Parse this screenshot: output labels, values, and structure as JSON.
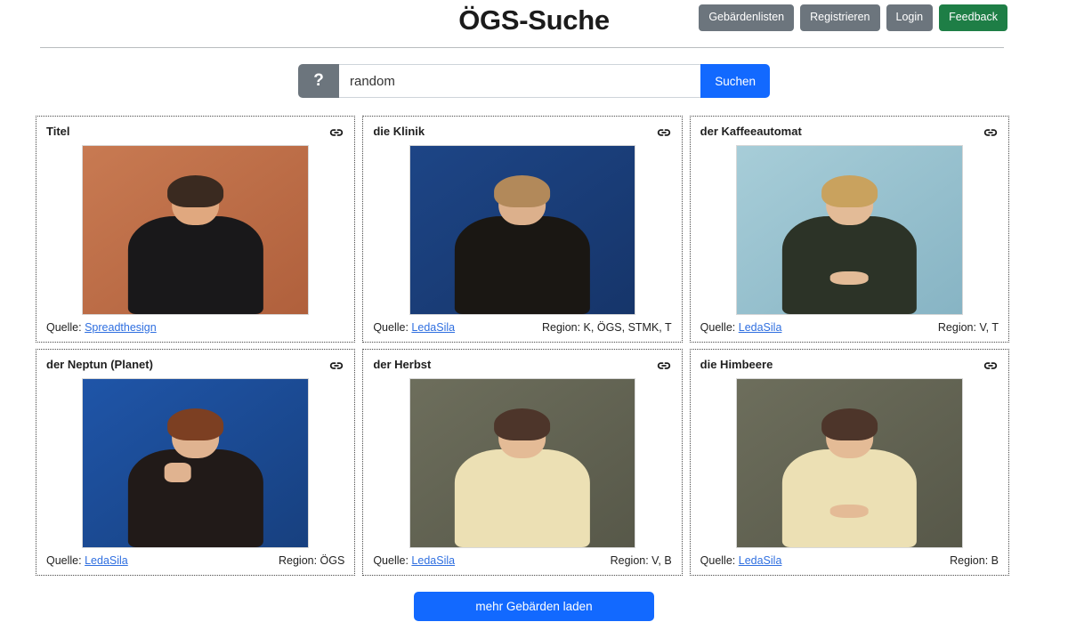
{
  "header": {
    "title": "ÖGS-Suche",
    "nav": [
      {
        "label": "Gebärdenlisten",
        "style": "grey"
      },
      {
        "label": "Registrieren",
        "style": "grey"
      },
      {
        "label": "Login",
        "style": "grey"
      },
      {
        "label": "Feedback",
        "style": "green"
      }
    ]
  },
  "search": {
    "help_icon": "?",
    "value": "random",
    "placeholder": "",
    "submit_label": "Suchen"
  },
  "results": {
    "source_prefix": "Quelle:",
    "region_prefix": "Region:",
    "link_icon": "chain-link-icon",
    "cards": [
      {
        "title": "Titel",
        "source": "Spreadthesign",
        "region": "",
        "bg": "#c87a52",
        "bg2": "#b0603c",
        "shirt": "#19181a",
        "skin": "#e0a87f",
        "hair": "#3a2a20",
        "pose": "neutral"
      },
      {
        "title": "die Klinik",
        "source": "LedaSila",
        "region": "K, ÖGS, STMK, T",
        "bg": "#1d4586",
        "bg2": "#16356a",
        "shirt": "#1a1713",
        "skin": "#dcb08c",
        "hair": "#b2895a",
        "pose": "neutral"
      },
      {
        "title": "der Kaffeeautomat",
        "source": "LedaSila",
        "region": "V, T",
        "bg": "#a7cdd8",
        "bg2": "#87b4c4",
        "shirt": "#2c3327",
        "skin": "#e3bb97",
        "hair": "#c9a25e",
        "pose": "hands-together"
      },
      {
        "title": "der Neptun (Planet)",
        "source": "LedaSila",
        "region": "ÖGS",
        "bg": "#1f55a8",
        "bg2": "#17407f",
        "shirt": "#211a18",
        "skin": "#e0b390",
        "hair": "#7c3f22",
        "pose": "fist-raised"
      },
      {
        "title": "der Herbst",
        "source": "LedaSila",
        "region": "V, B",
        "bg": "#6d6e5c",
        "bg2": "#575849",
        "shirt": "#ece0b4",
        "skin": "#e4bb96",
        "hair": "#4d352a",
        "pose": "neutral"
      },
      {
        "title": "die Himbeere",
        "source": "LedaSila",
        "region": "B",
        "bg": "#6d6e5c",
        "bg2": "#575849",
        "shirt": "#ece0b4",
        "skin": "#e4bb96",
        "hair": "#4d352a",
        "pose": "hands-together"
      }
    ]
  },
  "load_more": {
    "label": "mehr Gebärden laden"
  },
  "colors": {
    "primary_blue": "#1269ff",
    "grey_button": "#6c757d",
    "green_button": "#1e7e46",
    "link_blue": "#2f6fe0"
  }
}
